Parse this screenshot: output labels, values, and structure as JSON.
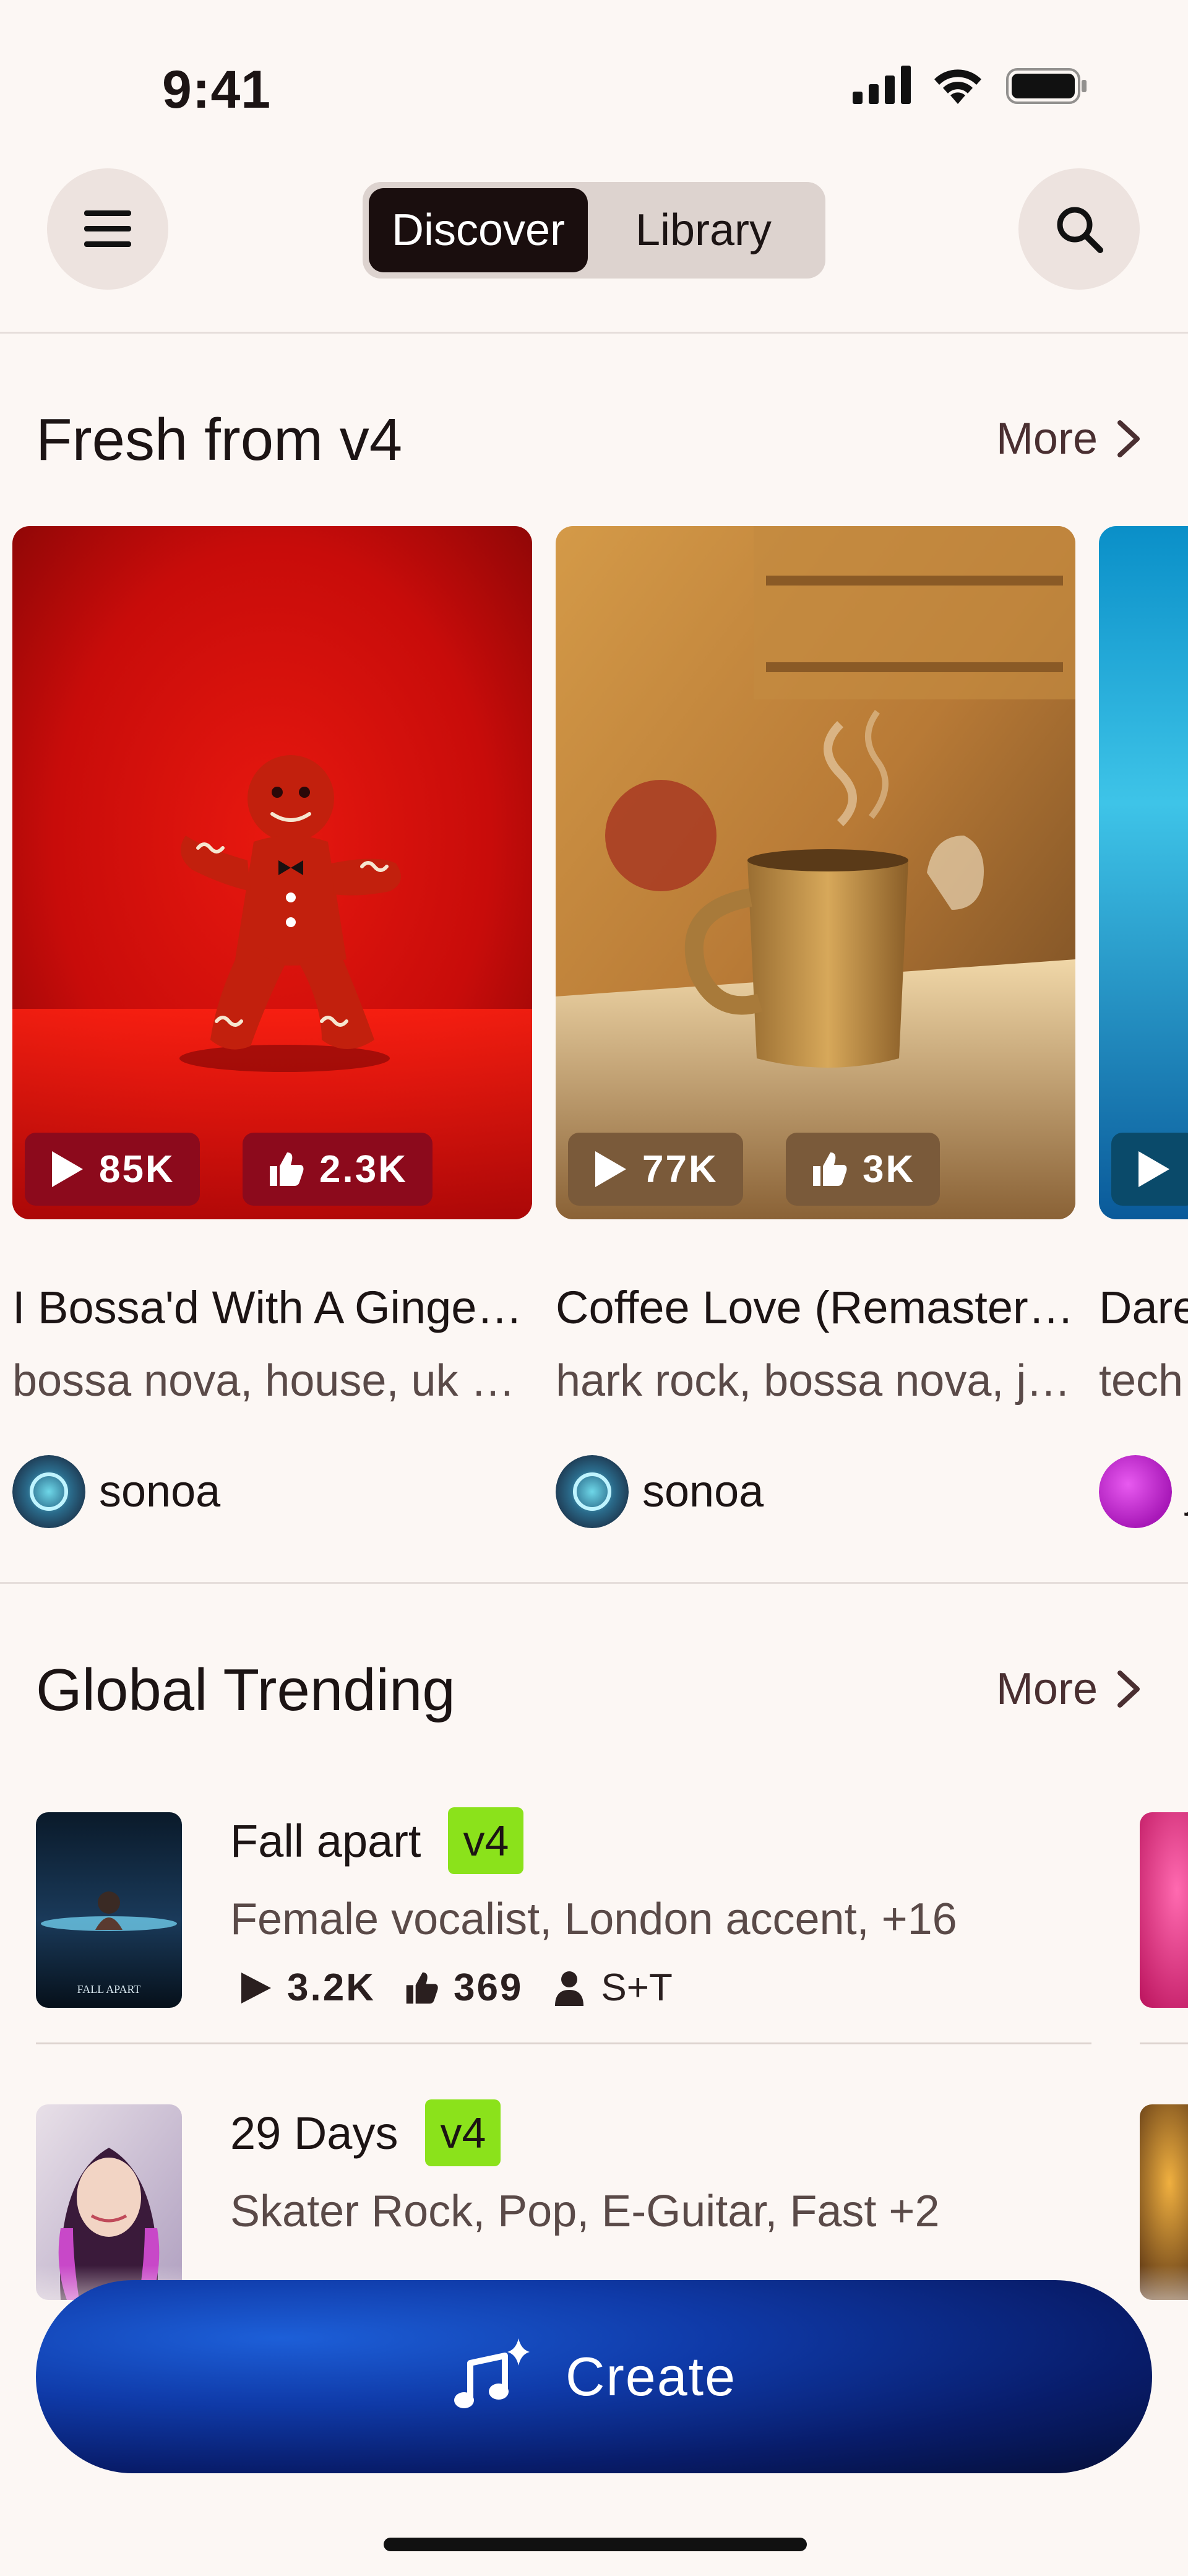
{
  "status_bar": {
    "time": "9:41"
  },
  "nav": {
    "tabs": [
      {
        "label": "Discover",
        "active": true
      },
      {
        "label": "Library",
        "active": false
      }
    ]
  },
  "fresh": {
    "title": "Fresh from v4",
    "more": "More",
    "cards": [
      {
        "plays": "85K",
        "likes": "2.3K",
        "title": "I Bossa'd With A Gingerbread Man",
        "tags": "bossa nova, house, uk garage",
        "user": "sonoa"
      },
      {
        "plays": "77K",
        "likes": "3K",
        "title": "Coffee Love (Remastered)",
        "tags": "hark rock, bossa nova, jazz",
        "user": "sonoa"
      },
      {
        "title": "Dare",
        "tags": "tech",
        "user": "j"
      }
    ]
  },
  "trending": {
    "title": "Global Trending",
    "more": "More",
    "rows": [
      {
        "title": "Fall apart",
        "badge": "v4",
        "tags": "Female vocalist, London accent, +16",
        "plays": "3.2K",
        "likes": "369",
        "user": "S+T",
        "cover_text": "FALL APART"
      },
      {
        "title": "29 Days",
        "badge": "v4",
        "tags": "Skater Rock, Pop, E-Guitar, Fast +2"
      }
    ]
  },
  "create_button": {
    "label": "Create"
  },
  "colors": {
    "background": "#FCF7F4",
    "active_tab": "#1A0E0E",
    "badge": "#8BE21B",
    "create_button": "#0f3aa8"
  }
}
